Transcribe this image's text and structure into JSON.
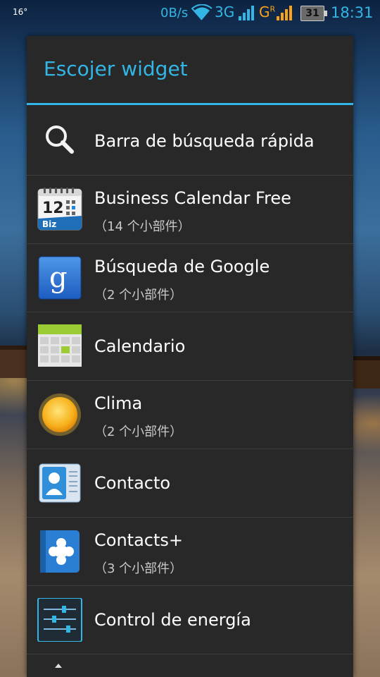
{
  "status_bar": {
    "temperature": "16°",
    "net_speed": "0B/s",
    "network_type": "3G",
    "network2": "G",
    "network2_sup": "R",
    "battery": "31",
    "time": "18:31"
  },
  "dialog": {
    "title": "Escojer widget",
    "items": [
      {
        "label": "Barra de búsqueda rápida",
        "sub": "",
        "icon": "search-icon"
      },
      {
        "label": "Business Calendar Free",
        "sub": "（14 个小部件）",
        "icon": "business-calendar-icon"
      },
      {
        "label": "Búsqueda de Google",
        "sub": "（2 个小部件）",
        "icon": "google-search-icon"
      },
      {
        "label": "Calendario",
        "sub": "",
        "icon": "calendar-icon"
      },
      {
        "label": "Clima",
        "sub": "（2 个小部件）",
        "icon": "weather-sun-icon"
      },
      {
        "label": "Contacto",
        "sub": "",
        "icon": "contact-card-icon"
      },
      {
        "label": "Contacts+",
        "sub": "（3 个小部件）",
        "icon": "contacts-plus-icon"
      },
      {
        "label": "Control de energía",
        "sub": "",
        "icon": "power-control-icon"
      }
    ]
  },
  "colors": {
    "accent": "#33b5e5",
    "dialog_bg": "#282828",
    "divider": "#3e3e3e"
  }
}
